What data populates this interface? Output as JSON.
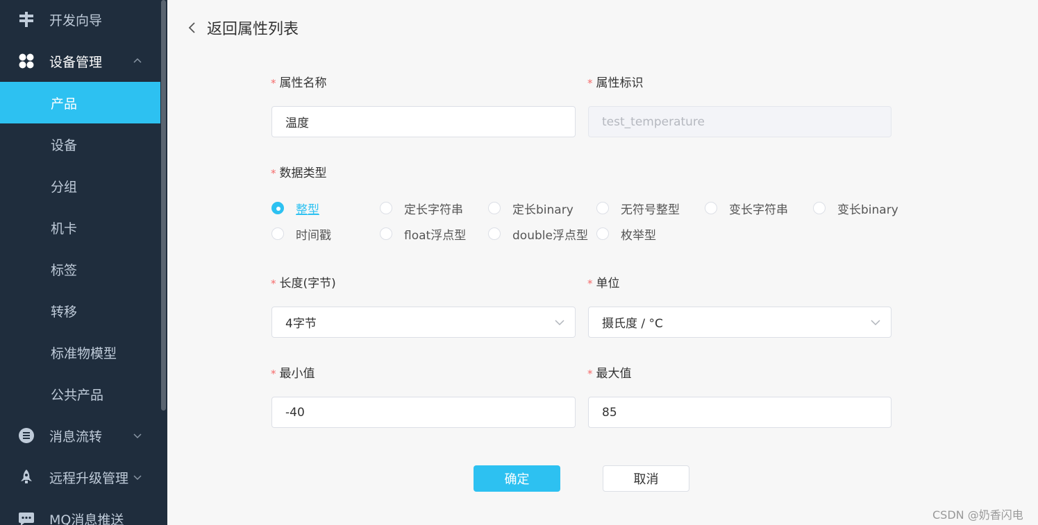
{
  "sidebar": {
    "groups": [
      {
        "label": "开发向导",
        "icon": "signpost-icon"
      },
      {
        "label": "设备管理",
        "icon": "grid-icon",
        "expanded": true
      },
      {
        "label": "消息流转",
        "icon": "message-icon"
      },
      {
        "label": "远程升级管理",
        "icon": "rocket-icon"
      },
      {
        "label": "MQ消息推送",
        "icon": "chat-icon"
      }
    ],
    "items": [
      {
        "label": "产品",
        "active": true
      },
      {
        "label": "设备"
      },
      {
        "label": "分组"
      },
      {
        "label": "机卡"
      },
      {
        "label": "标签"
      },
      {
        "label": "转移"
      },
      {
        "label": "标准物模型"
      },
      {
        "label": "公共产品"
      }
    ]
  },
  "header": {
    "back_label": "返回属性列表"
  },
  "form": {
    "attr_name": {
      "label": "属性名称",
      "value": "温度"
    },
    "attr_id": {
      "label": "属性标识",
      "value": "test_temperature"
    },
    "data_type": {
      "label": "数据类型",
      "selected": "整型",
      "options": [
        "整型",
        "定长字符串",
        "定长binary",
        "无符号整型",
        "变长字符串",
        "变长binary",
        "时间戳",
        "float浮点型",
        "double浮点型",
        "枚举型"
      ]
    },
    "length": {
      "label": "长度(字节)",
      "value": "4字节"
    },
    "unit": {
      "label": "单位",
      "value": "摄氏度 / °C"
    },
    "min": {
      "label": "最小值",
      "value": "-40"
    },
    "max": {
      "label": "最大值",
      "value": "85"
    },
    "confirm_label": "确定",
    "cancel_label": "取消"
  },
  "watermark": "CSDN @奶香闪电",
  "colors": {
    "accent": "#2dc1f1",
    "sidebar_bg": "#1f2d3d",
    "required": "#f56c6c"
  }
}
